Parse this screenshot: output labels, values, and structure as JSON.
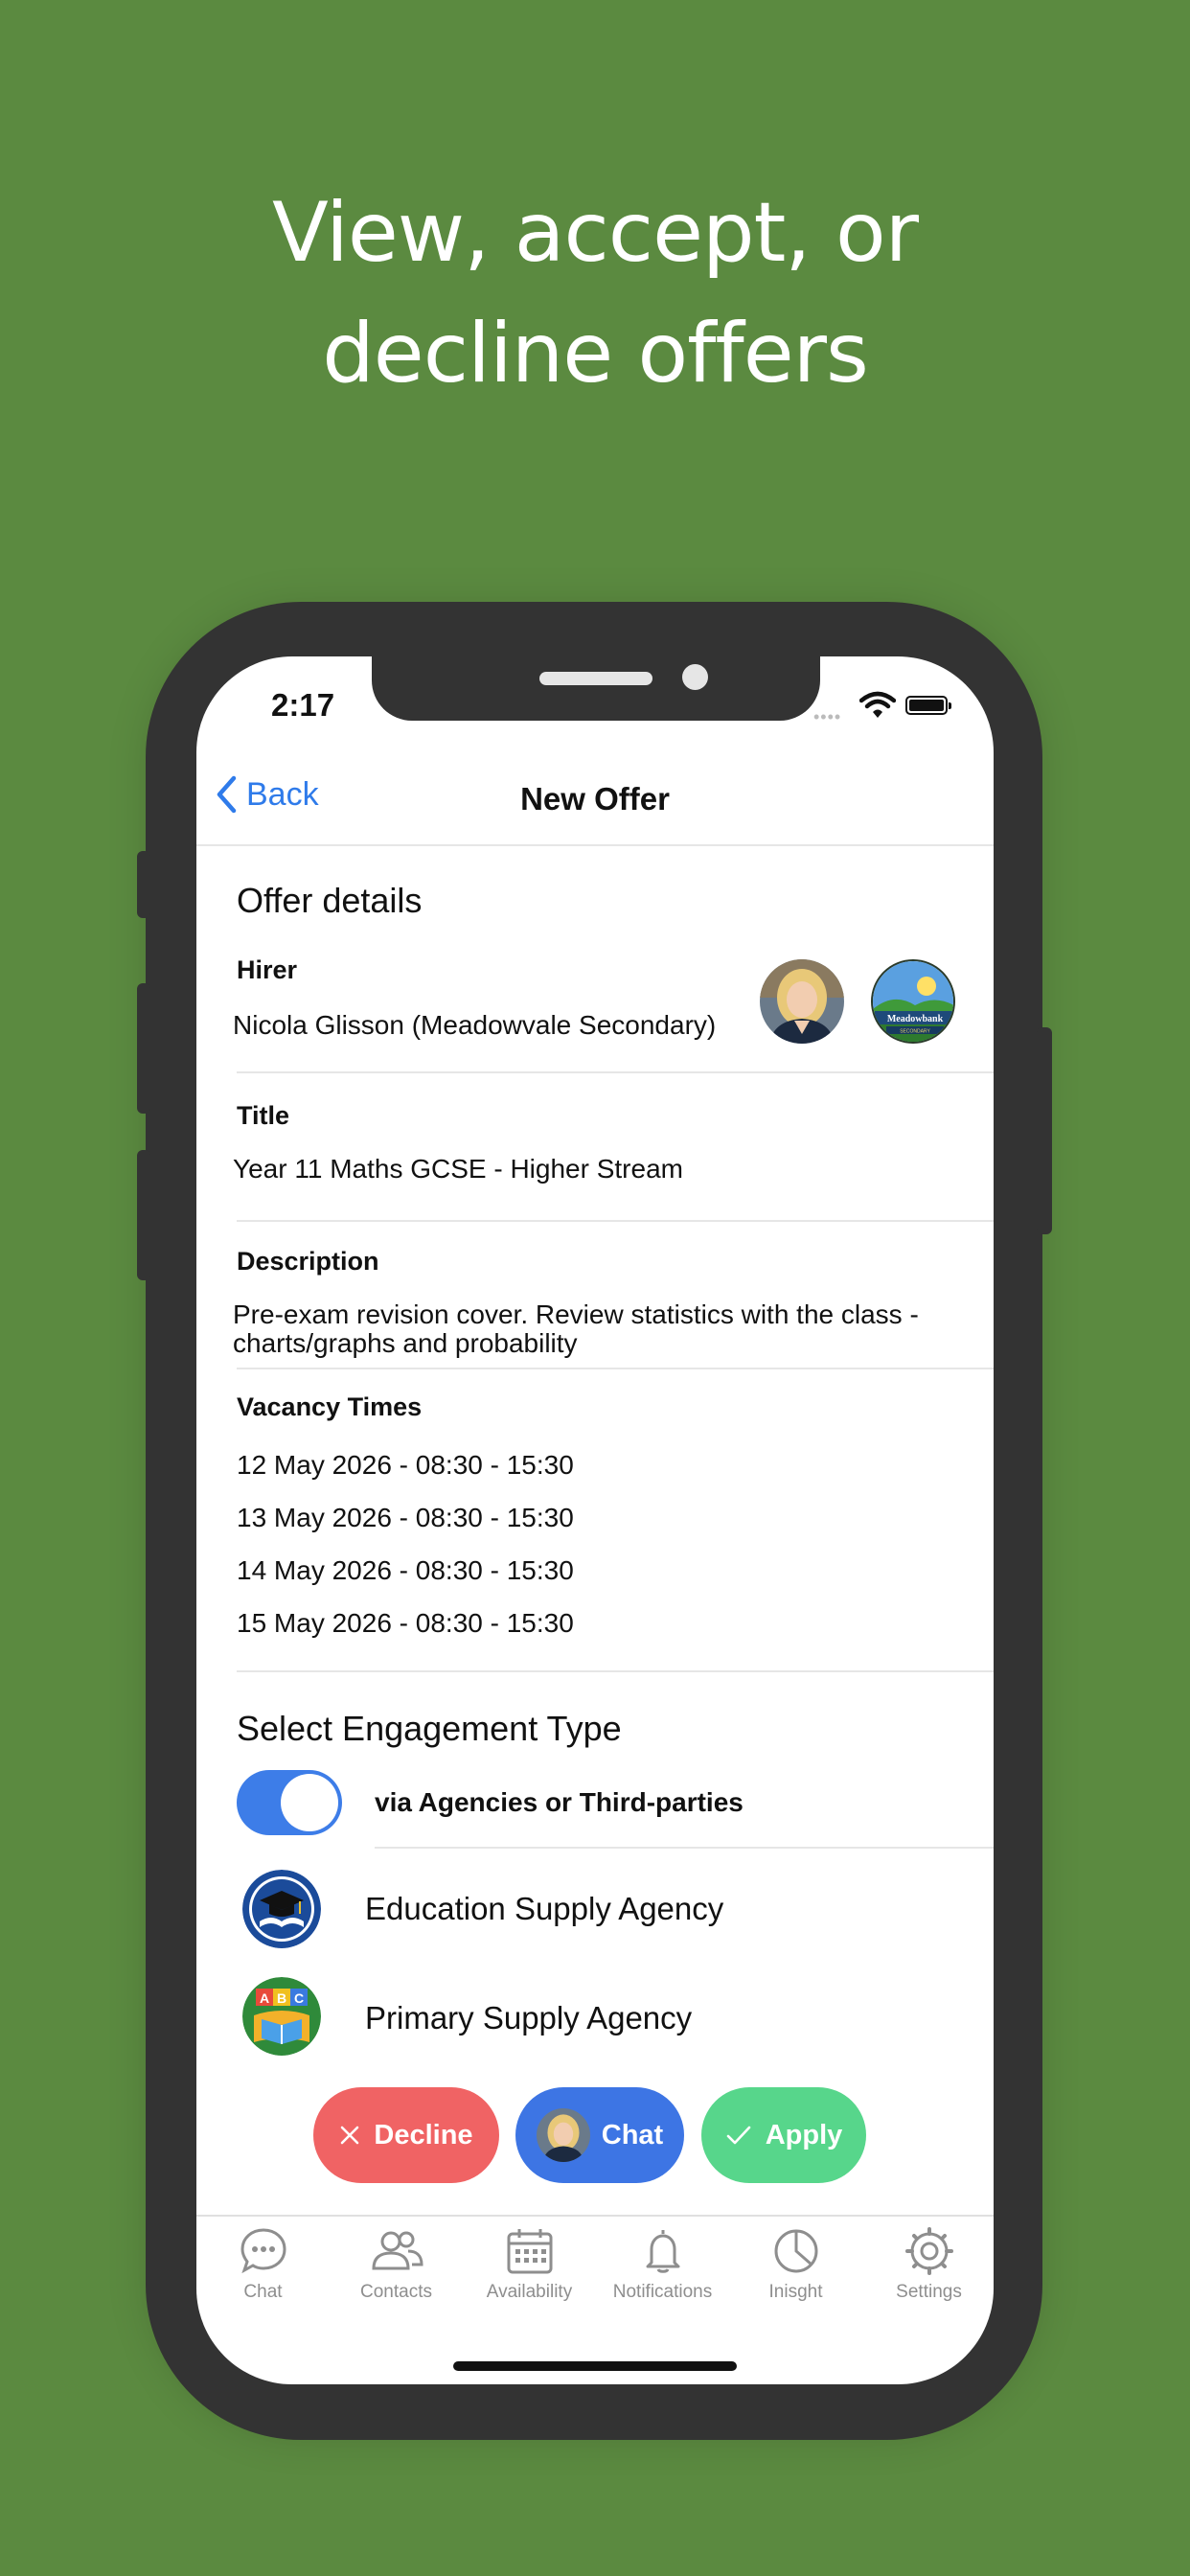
{
  "headline": "View, accept, or decline offers",
  "status_bar": {
    "time": "2:17"
  },
  "nav": {
    "back_label": "Back",
    "title": "New Offer"
  },
  "offer": {
    "section_title": "Offer details",
    "hirer_label": "Hirer",
    "hirer_value": "Nicola Glisson (Meadowvale Secondary)",
    "school_logo_text": "Meadowbank",
    "school_logo_subtext": "SECONDARY",
    "title_label": "Title",
    "title_value": "Year 11 Maths GCSE - Higher Stream",
    "description_label": "Description",
    "description_value": "Pre-exam revision cover. Review statistics with the class - charts/graphs and probability",
    "vacancy_label": "Vacancy Times",
    "vacancy_times": [
      "12 May 2026 - 08:30 - 15:30",
      "13 May 2026 - 08:30 - 15:30",
      "14 May 2026 - 08:30 - 15:30",
      "15 May 2026 - 08:30 - 15:30"
    ]
  },
  "engagement": {
    "section_title": "Select Engagement Type",
    "toggle_on": true,
    "toggle_label": "via Agencies or Third-parties",
    "agencies": [
      {
        "name": "Education Supply Agency",
        "icon": "graduation-cap-book-logo"
      },
      {
        "name": "Primary Supply Agency",
        "icon": "abc-blocks-logo"
      }
    ]
  },
  "actions": {
    "decline_label": "Decline",
    "chat_label": "Chat",
    "apply_label": "Apply"
  },
  "tabs": [
    {
      "label": "Chat",
      "icon": "chat-bubble-icon"
    },
    {
      "label": "Contacts",
      "icon": "contacts-icon"
    },
    {
      "label": "Availability",
      "icon": "calendar-icon"
    },
    {
      "label": "Notifications",
      "icon": "bell-icon"
    },
    {
      "label": "Inisght",
      "icon": "pie-chart-icon"
    },
    {
      "label": "Settings",
      "icon": "gear-icon"
    }
  ],
  "colors": {
    "background": "#5b8a40",
    "accent_blue": "#3d75e4",
    "decline_red": "#f06364",
    "apply_green": "#57d68b",
    "link_blue": "#2f7bea"
  }
}
